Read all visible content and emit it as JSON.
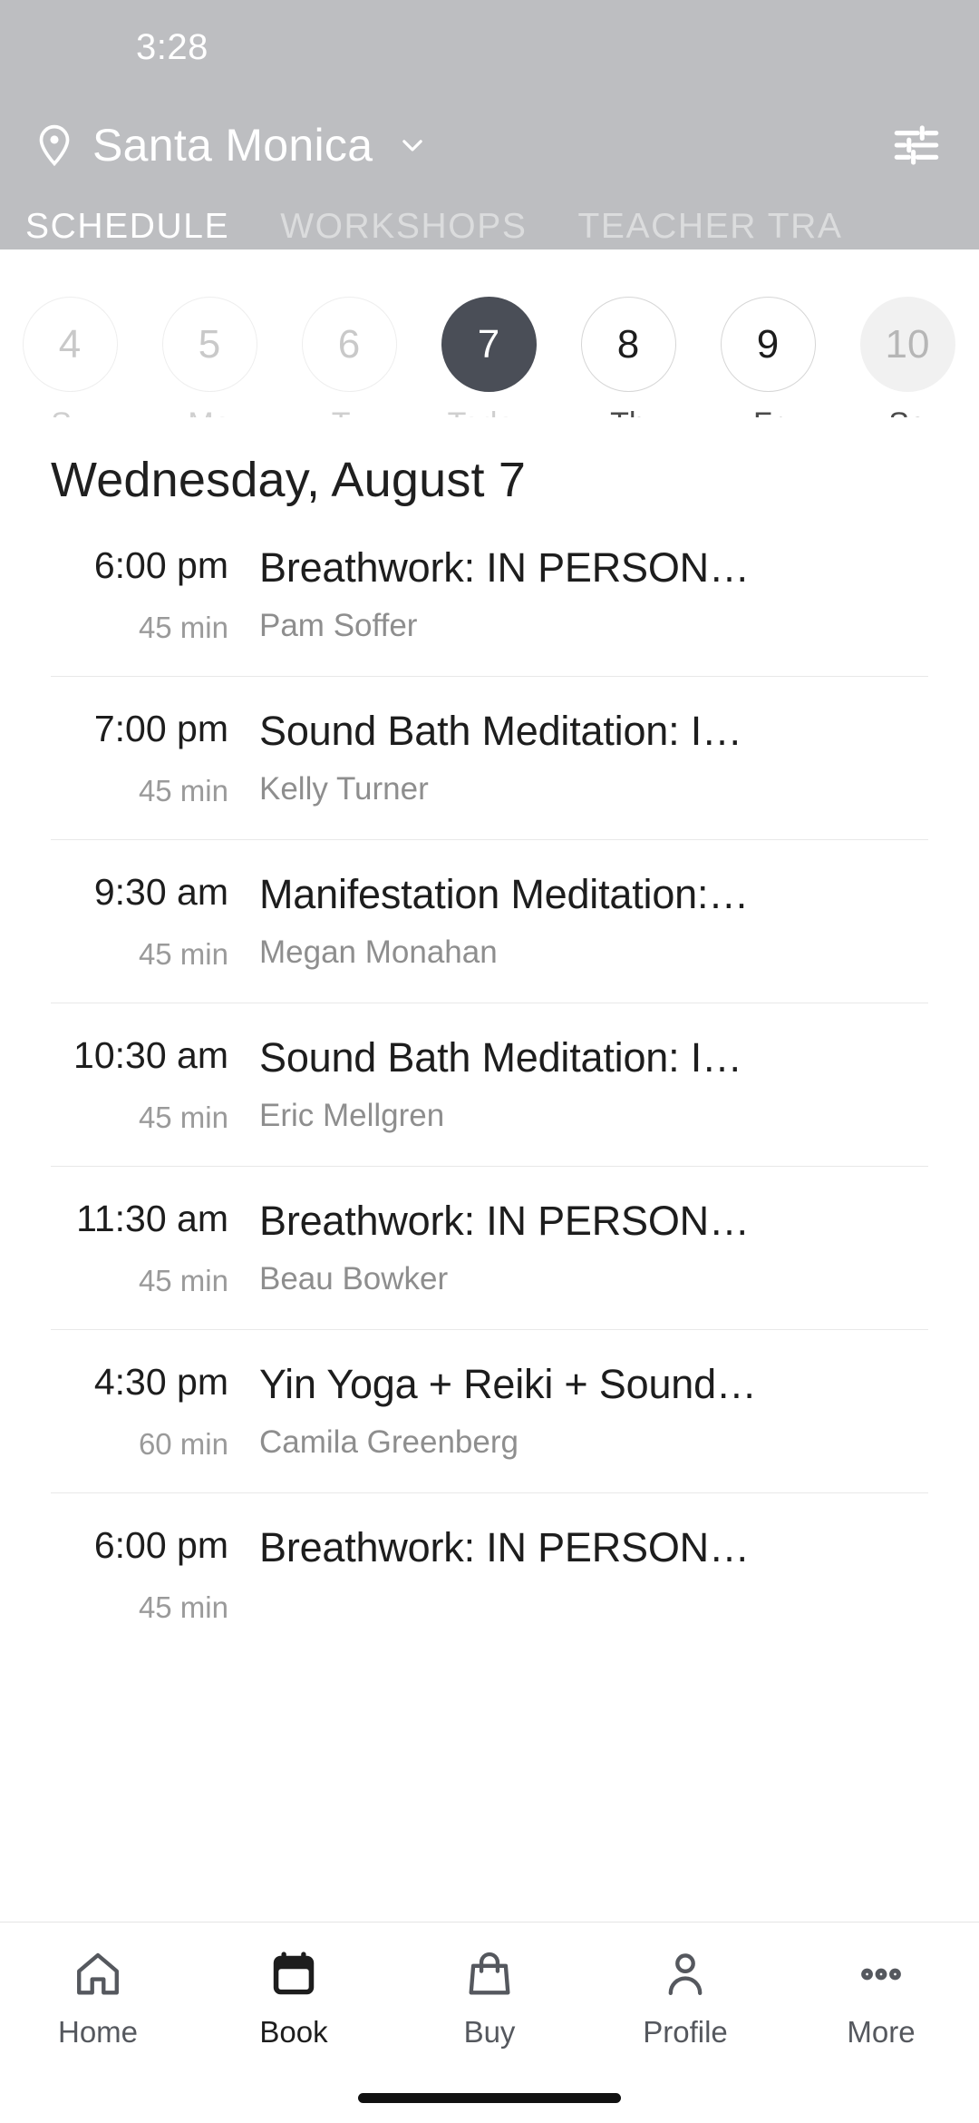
{
  "status_bar": {
    "time": "3:28"
  },
  "header": {
    "location_icon": "location-pin-icon",
    "location": "Santa Monica",
    "chevron_icon": "chevron-down-icon",
    "filter_icon": "filter-tune-icon",
    "accent_bg": "#bdbec1",
    "tabs": [
      {
        "label": "SCHEDULE",
        "active": true
      },
      {
        "label": "WORKSHOPS",
        "active": false
      },
      {
        "label": "TEACHER TRA",
        "active": false
      }
    ]
  },
  "date_strip": {
    "days": [
      {
        "num": "4",
        "label": "Su",
        "state": "past"
      },
      {
        "num": "5",
        "label": "Mo",
        "state": "past"
      },
      {
        "num": "6",
        "label": "Tu",
        "state": "past"
      },
      {
        "num": "7",
        "label": "Today",
        "state": "selected"
      },
      {
        "num": "8",
        "label": "Th",
        "state": "future"
      },
      {
        "num": "9",
        "label": "Fr",
        "state": "future"
      },
      {
        "num": "10",
        "label": "Sa",
        "state": "filled"
      }
    ],
    "selected_color": "#4a4e57"
  },
  "day_title": "Wednesday, August 7",
  "classes": [
    {
      "time": "6:00 pm",
      "duration": "45 min",
      "name": "Breathwork: IN PERSON…",
      "teacher": "Pam Soffer"
    },
    {
      "time": "7:00 pm",
      "duration": "45 min",
      "name": "Sound Bath Meditation: I…",
      "teacher": "Kelly Turner"
    },
    {
      "time": "9:30 am",
      "duration": "45 min",
      "name": "Manifestation Meditation:…",
      "teacher": "Megan Monahan"
    },
    {
      "time": "10:30 am",
      "duration": "45 min",
      "name": "Sound Bath Meditation: I…",
      "teacher": "Eric Mellgren"
    },
    {
      "time": "11:30 am",
      "duration": "45 min",
      "name": "Breathwork: IN PERSON…",
      "teacher": "Beau Bowker"
    },
    {
      "time": "4:30 pm",
      "duration": "60 min",
      "name": "Yin Yoga + Reiki + Sound…",
      "teacher": "Camila Greenberg"
    },
    {
      "time": "6:00 pm",
      "duration": "45 min",
      "name": "Breathwork: IN PERSON…",
      "teacher": ""
    }
  ],
  "bottom_nav": {
    "items": [
      {
        "label": "Home",
        "icon": "home-icon",
        "active": false
      },
      {
        "label": "Book",
        "icon": "calendar-icon",
        "active": true
      },
      {
        "label": "Buy",
        "icon": "shopping-bag-icon",
        "active": false
      },
      {
        "label": "Profile",
        "icon": "person-icon",
        "active": false
      },
      {
        "label": "More",
        "icon": "more-dots-icon",
        "active": false
      }
    ]
  }
}
